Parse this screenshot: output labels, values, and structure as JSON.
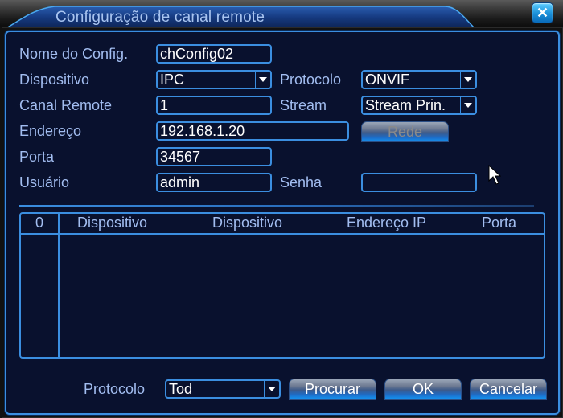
{
  "window": {
    "title": "Configuração de canal remote",
    "close_icon": "close-icon"
  },
  "form": {
    "config_name": {
      "label": "Nome do Config.",
      "value": "chConfig02"
    },
    "device": {
      "label": "Dispositivo",
      "value": "IPC"
    },
    "protocol": {
      "label": "Protocolo",
      "value": "ONVIF"
    },
    "remote_channel": {
      "label": "Canal Remote",
      "value": "1"
    },
    "stream": {
      "label": "Stream",
      "value": "Stream Prin."
    },
    "address": {
      "label": "Endereço",
      "value": "192.168.1.20"
    },
    "network_button": "Rede",
    "port": {
      "label": "Porta",
      "value": "34567"
    },
    "user": {
      "label": "Usuário",
      "value": "admin"
    },
    "password": {
      "label": "Senha",
      "value": ""
    }
  },
  "table": {
    "columns": [
      "0",
      "Dispositivo",
      "Dispositivo",
      "Endereço IP",
      "Porta"
    ],
    "rows": []
  },
  "footer": {
    "protocol_label": "Protocolo",
    "protocol_value": "Tod",
    "search_button": "Procurar",
    "ok_button": "OK",
    "cancel_button": "Cancelar"
  }
}
